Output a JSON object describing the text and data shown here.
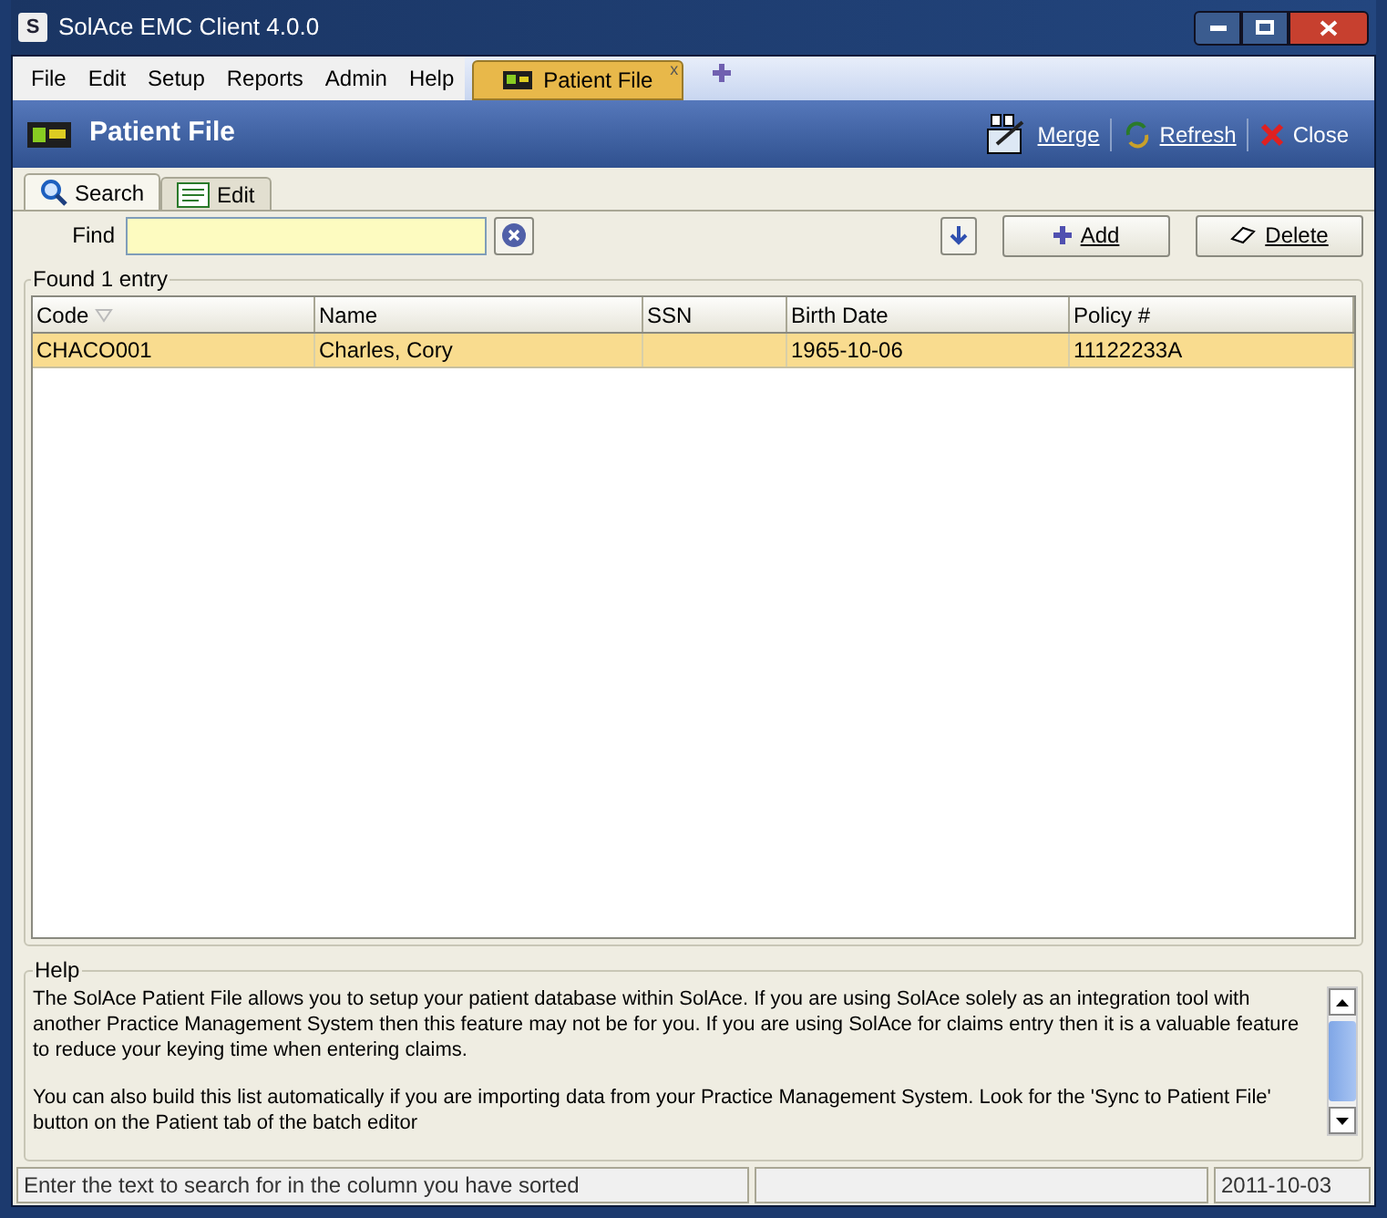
{
  "window": {
    "icon": "S",
    "title": "SolAce EMC Client 4.0.0"
  },
  "menu": [
    "File",
    "Edit",
    "Setup",
    "Reports",
    "Admin",
    "Help"
  ],
  "doc_tab": {
    "label": "Patient File",
    "close": "x"
  },
  "header": {
    "title": "Patient File",
    "actions": [
      {
        "kind": "merge",
        "label": "Merge"
      },
      {
        "kind": "refresh",
        "label": "Refresh"
      },
      {
        "kind": "close",
        "label": "Close"
      }
    ]
  },
  "tabs": [
    {
      "kind": "search",
      "label": "Search",
      "selected": true
    },
    {
      "kind": "edit",
      "label": "Edit",
      "selected": false
    }
  ],
  "find": {
    "label": "Find"
  },
  "buttons": [
    {
      "kind": "add",
      "label": "Add"
    },
    {
      "kind": "delete",
      "label": "Delete"
    }
  ],
  "results": {
    "caption": "Found 1 entry",
    "columns": [
      "Code",
      "Name",
      "SSN",
      "Birth Date",
      "Policy #"
    ],
    "rows": [
      {
        "selected": true,
        "cells": [
          "CHACO001",
          "Charles, Cory",
          "",
          "1965-10-06",
          "11122233A"
        ]
      }
    ]
  },
  "help": {
    "caption": "Help",
    "paragraphs": [
      "The SolAce Patient File allows you to setup your patient database within SolAce.  If you are using SolAce solely as an integration tool with another Practice Management System then this feature may not be for you.  If you are using SolAce for claims entry then it is a valuable feature to reduce your keying time when entering claims.",
      "You can also build this list automatically if you are importing data from your Practice Management System.  Look for the 'Sync to Patient File' button on the Patient tab of the batch editor"
    ]
  },
  "status_bar": {
    "message": "Enter the text to search for in the column you have sorted",
    "date": "2011-10-03"
  }
}
